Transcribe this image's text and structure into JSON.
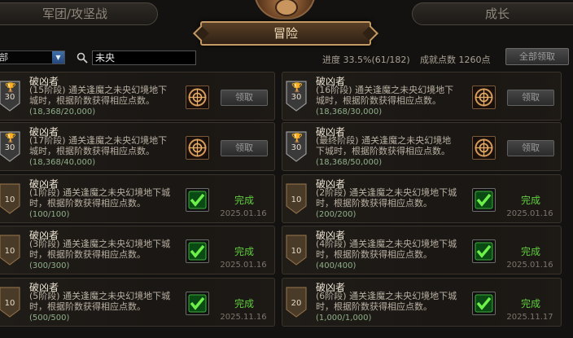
{
  "tabs": {
    "left": "军团/攻坚战",
    "right": "成长",
    "active": "冒险"
  },
  "filter": {
    "category_value": "全部",
    "category_visible": "部",
    "search_value": "未央"
  },
  "stats": {
    "progress": "进度 33.5%(61/182)",
    "points": "成就点数 1260点"
  },
  "claim_all_label": "全部领取",
  "cards": [
    {
      "title": "破凶者",
      "desc": "(15阶段) 通关逢魔之未央幻境地下城时，根据阶数获得相应点数。",
      "progress": "(18,368/20,000)",
      "badge": "30",
      "state": "claim",
      "button": "领取"
    },
    {
      "title": "破凶者",
      "desc": "(16阶段) 通关逢魔之未央幻境地下城时，根据阶数获得相应点数。",
      "progress": "(18,368/30,000)",
      "badge": "30",
      "state": "claim",
      "button": "领取"
    },
    {
      "title": "破凶者",
      "desc": "(17阶段) 通关逢魔之未央幻境地下城时，根据阶数获得相应点数。",
      "progress": "(18,368/40,000)",
      "badge": "30",
      "state": "claim",
      "button": "领取"
    },
    {
      "title": "破凶者",
      "desc": "(最终阶段) 通关逢魔之未央幻境地下城时，根据阶数获得相应点数。",
      "progress": "(18,368/50,000)",
      "badge": "30",
      "state": "claim",
      "button": "领取"
    },
    {
      "title": "破凶者",
      "desc": "(1阶段) 通关逢魔之未央幻境地下城时，根据阶数获得相应点数。",
      "progress": "(100/100)",
      "badge": "10",
      "state": "done",
      "status": "完成",
      "date": "2025.01.16"
    },
    {
      "title": "破凶者",
      "desc": "(2阶段) 通关逢魔之未央幻境地下城时，根据阶数获得相应点数。",
      "progress": "(200/200)",
      "badge": "10",
      "state": "done",
      "status": "完成",
      "date": "2025.01.16"
    },
    {
      "title": "破凶者",
      "desc": "(3阶段) 通关逢魔之未央幻境地下城时，根据阶数获得相应点数。",
      "progress": "(300/300)",
      "badge": "10",
      "state": "done",
      "status": "完成",
      "date": "2025.01.16"
    },
    {
      "title": "破凶者",
      "desc": "(4阶段) 通关逢魔之未央幻境地下城时，根据阶数获得相应点数。",
      "progress": "(400/400)",
      "badge": "10",
      "state": "done",
      "status": "完成",
      "date": "2025.01.16"
    },
    {
      "title": "破凶者",
      "desc": "(5阶段) 通关逢魔之未央幻境地下城时，根据阶数获得相应点数。",
      "progress": "(500/500)",
      "badge": "10",
      "state": "done",
      "status": "完成",
      "date": "2025.11.16"
    },
    {
      "title": "破凶者",
      "desc": "(6阶段) 通关逢魔之未央幻境地下城时，根据阶数获得相应点数。",
      "progress": "(1,000/1,000)",
      "badge": "20",
      "state": "done",
      "status": "完成",
      "date": "2025.11.17"
    }
  ],
  "colors": {
    "accent_gold": "#c49a64",
    "complete_green": "#5fcf3a",
    "badge_dark": "#3d3226"
  },
  "icons": {
    "search": "search-icon",
    "trophy": "trophy-icon",
    "reward": "reward-emblem-icon",
    "check": "check-icon",
    "dropdown": "chevron-down-icon"
  }
}
